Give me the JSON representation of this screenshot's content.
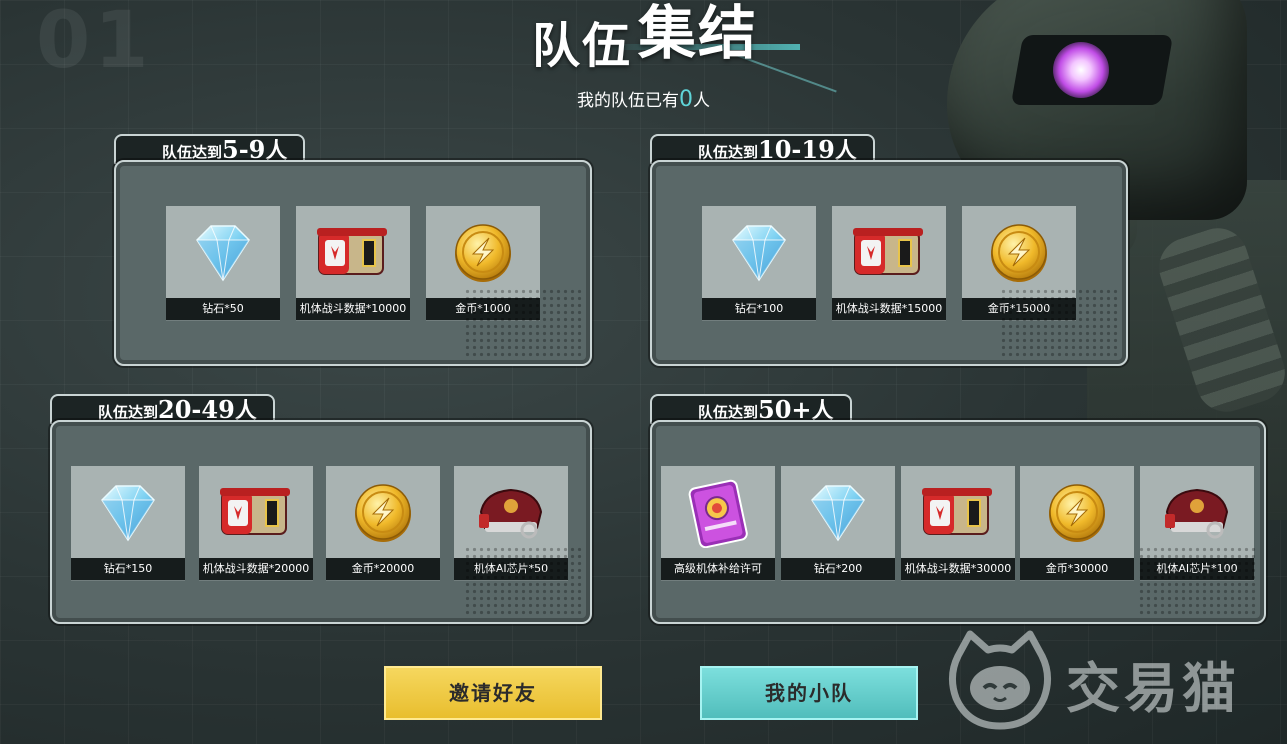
{
  "header": {
    "title_part1": "队伍",
    "title_part2": "集结",
    "count_prefix": "我的队伍已有",
    "count_value": "0",
    "count_suffix": "人",
    "bg_number": "01"
  },
  "tiers": [
    {
      "prefix": "队伍达到",
      "range": "5-9",
      "suffix": "人",
      "rewards": [
        {
          "icon": "diamond-icon",
          "label": "钻石*50"
        },
        {
          "icon": "battle-data-icon",
          "label": "机体战斗数据*10000"
        },
        {
          "icon": "gold-coin-icon",
          "label": "金币*1000"
        }
      ]
    },
    {
      "prefix": "队伍达到",
      "range": "10-19",
      "suffix": "人",
      "rewards": [
        {
          "icon": "diamond-icon",
          "label": "钻石*100"
        },
        {
          "icon": "battle-data-icon",
          "label": "机体战斗数据*15000"
        },
        {
          "icon": "gold-coin-icon",
          "label": "金币*15000"
        }
      ]
    },
    {
      "prefix": "队伍达到",
      "range": "20-49",
      "suffix": "人",
      "rewards": [
        {
          "icon": "diamond-icon",
          "label": "钻石*150"
        },
        {
          "icon": "battle-data-icon",
          "label": "机体战斗数据*20000"
        },
        {
          "icon": "gold-coin-icon",
          "label": "金币*20000"
        },
        {
          "icon": "ai-chip-icon",
          "label": "机体AI芯片*50"
        }
      ]
    },
    {
      "prefix": "队伍达到",
      "range": "50+",
      "suffix": "人",
      "rewards": [
        {
          "icon": "supply-license-icon",
          "label": "高级机体补给许可"
        },
        {
          "icon": "diamond-icon",
          "label": "钻石*200"
        },
        {
          "icon": "battle-data-icon",
          "label": "机体战斗数据*30000"
        },
        {
          "icon": "gold-coin-icon",
          "label": "金币*30000"
        },
        {
          "icon": "ai-chip-icon",
          "label": "机体AI芯片*100"
        }
      ]
    }
  ],
  "buttons": {
    "invite_label": "邀请好友",
    "my_team_label": "我的小队"
  },
  "watermark": {
    "text": "交易猫"
  },
  "colors": {
    "accent_cyan": "#5fd4d8",
    "invite_yellow": "#f0cc48",
    "team_cyan": "#66d0ce",
    "panel": "#5a6868",
    "mech_eye": "#c04ce6"
  }
}
